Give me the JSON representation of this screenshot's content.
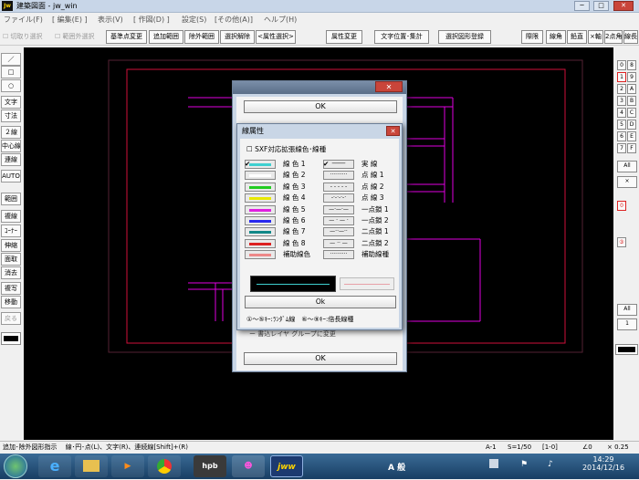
{
  "window": {
    "title": "建築図面 - jw_win",
    "app_icon_text": "Jw",
    "min": "─",
    "max": "□",
    "close": "✕"
  },
  "menu": [
    "ファイル(F)",
    "[ 編集(E) ]",
    "表示(V)",
    "[ 作図(D) ]",
    "設定(S)",
    "[その他(A)]",
    "ヘルプ(H)"
  ],
  "toolbar": {
    "chk1": "切取り選択",
    "chk2": "範囲外選択",
    "buttons": [
      "基準点変更",
      "追加範囲",
      "除外範囲",
      "選択解除",
      "<属性選択>",
      "属性変更",
      "文字位置･集計",
      "選択図形登録"
    ],
    "right": [
      "際限",
      "線角",
      "鉛直",
      "×軸",
      "2点角",
      "線長"
    ]
  },
  "left_tools": [
    "／",
    "□",
    "○",
    "文字",
    "寸法",
    "２線",
    "中心線",
    "連線",
    "AUTO",
    "範囲",
    "複線",
    "ｺｰﾅｰ",
    "伸縮",
    "面取",
    "消去",
    "複写",
    "移動",
    "戻る"
  ],
  "right_tools": {
    "pairs": [
      [
        "0",
        "8"
      ],
      [
        "1",
        "9"
      ],
      [
        "2",
        "A"
      ],
      [
        "3",
        "B"
      ],
      [
        "4",
        "C"
      ],
      [
        "5",
        "D"
      ],
      [
        "6",
        "E"
      ],
      [
        "7",
        "F"
      ]
    ],
    "all1": "All",
    "x1": "×",
    "layer0": "0",
    "layer3": "③",
    "all2": "All",
    "one": "1"
  },
  "dialog_outer": {
    "ok_top": "OK",
    "ok_bottom": "OK",
    "partial_text": "ー 書込レイヤ グループに変更"
  },
  "dialog": {
    "title": "線属性",
    "close": "✕",
    "sxf_label": "SXF対応拡張線色･線種",
    "colors": [
      {
        "label": "線 色 1",
        "hex": "#3fd0d0",
        "checked": true
      },
      {
        "label": "線 色 2",
        "hex": "#ffffff",
        "checked": false
      },
      {
        "label": "線 色 3",
        "hex": "#22cc22",
        "checked": false
      },
      {
        "label": "線 色 4",
        "hex": "#e8e800",
        "checked": false
      },
      {
        "label": "線 色 5",
        "hex": "#e020e0",
        "checked": false
      },
      {
        "label": "線 色 6",
        "hex": "#2a2aee",
        "checked": false
      },
      {
        "label": "線 色 7",
        "hex": "#118888",
        "checked": false
      },
      {
        "label": "線 色 8",
        "hex": "#dd2222",
        "checked": false
      },
      {
        "label": "補助線色",
        "hex": "#ee8888",
        "checked": false
      }
    ],
    "types": [
      {
        "label": "実 線",
        "glyph": "────",
        "checked": true
      },
      {
        "label": "点 線 1",
        "glyph": "··········",
        "checked": false
      },
      {
        "label": "点 線 2",
        "glyph": "- - - - -",
        "checked": false
      },
      {
        "label": "点 線 3",
        "glyph": "-·-·-·-·",
        "checked": false
      },
      {
        "label": "一点鎖 1",
        "glyph": "—·—·—",
        "checked": false
      },
      {
        "label": "一点鎖 2",
        "glyph": "— · — ·",
        "checked": false
      },
      {
        "label": "二点鎖 1",
        "glyph": "—··—··",
        "checked": false
      },
      {
        "label": "二点鎖 2",
        "glyph": "— ·· —",
        "checked": false
      },
      {
        "label": "補助線種",
        "glyph": "··········",
        "checked": false
      }
    ],
    "ok": "Ok",
    "hint": "①～⑤ｷｰ:ﾗﾝﾀﾞﾑ線　⑥～⑨ｷｰ:倍長線種"
  },
  "status": {
    "left": "追加･除外図形指示　 線･円･点(L)、文字(R)、連続線[Shift]+(R)",
    "paper": "A-1",
    "scale": "S=1/50",
    "layer": "[1-0]",
    "angle": "∠0",
    "zoom": "× 0.25"
  },
  "taskbar": {
    "time": "14:29",
    "date": "2014/12/16",
    "apps": [
      "hpb",
      "jww"
    ],
    "tray": "A 般"
  },
  "colors": {
    "magenta": "#e000e0",
    "red": "#d0103a",
    "canvas": "#000000"
  }
}
